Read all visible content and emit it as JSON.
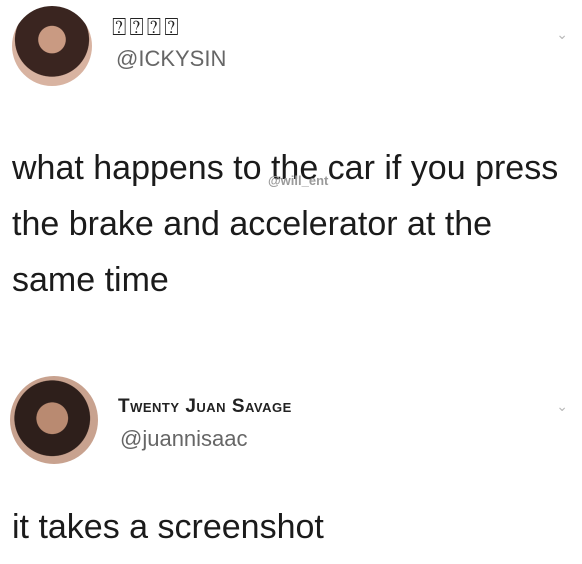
{
  "tweet1": {
    "display_name": "⍰⍰⍰⍰",
    "handle": "@ICKYSIN",
    "text": "what happens to the car if you press the brake and accelerator at the same time",
    "watermark": "@will_ent",
    "menu_icon": "chevron-down-icon"
  },
  "tweet2": {
    "display_name": "Twenty Juan Savage",
    "handle": "@juannisaac",
    "text": "it takes a screenshot",
    "menu_icon": "chevron-down-icon"
  }
}
